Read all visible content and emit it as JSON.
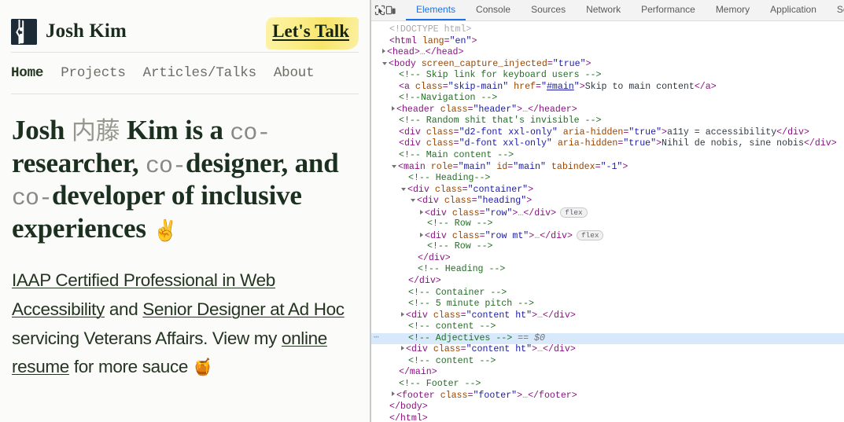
{
  "site": {
    "brand_name": "Josh Kim",
    "logo_icon": "josh-kim-monogram-icon",
    "cta": {
      "label": "Let's Talk",
      "highlight_color": "#f8e46b"
    },
    "nav": [
      {
        "label": "Home",
        "active": true
      },
      {
        "label": "Projects",
        "active": false
      },
      {
        "label": "Articles/Talks",
        "active": false
      },
      {
        "label": "About",
        "active": false
      }
    ],
    "heading": {
      "part1": "Josh ",
      "cjk": "内藤",
      "part2": " Kim is a ",
      "co1": "co-",
      "part3": "researcher, ",
      "co2": "co-",
      "part4": "designer, and ",
      "co3": "co-",
      "part5": "developer of inclusive experiences ",
      "emoji": "✌️"
    },
    "pitch": {
      "link1": "IAAP Certified Professional in Web Accessibility",
      "mid1": " and ",
      "link2": "Senior Designer at Ad Hoc",
      "mid2": " servicing Veterans Affairs. View my ",
      "link3": "online resume",
      "mid3": " for more sauce ",
      "emoji": "🍯"
    },
    "text_color": "#243521",
    "heading_color": "#1c3020"
  },
  "devtools": {
    "icons": [
      {
        "name": "inspect-element-icon"
      },
      {
        "name": "device-toolbar-icon"
      }
    ],
    "tabs": [
      {
        "label": "Elements",
        "active": true
      },
      {
        "label": "Console",
        "active": false
      },
      {
        "label": "Sources",
        "active": false
      },
      {
        "label": "Network",
        "active": false
      },
      {
        "label": "Performance",
        "active": false
      },
      {
        "label": "Memory",
        "active": false
      },
      {
        "label": "Application",
        "active": false
      },
      {
        "label": "Security",
        "active": false
      }
    ],
    "accent_color": "#1a73e8",
    "selection_color": "#d8e9fb",
    "selected_marker": "== $0",
    "dom": [
      {
        "indent": 0,
        "twisty": "none",
        "type": "doctype",
        "text": "<!DOCTYPE html>"
      },
      {
        "indent": 0,
        "twisty": "none",
        "type": "open",
        "tag": "html",
        "attrs": [
          {
            "name": "lang",
            "value": "en"
          }
        ]
      },
      {
        "indent": 0,
        "twisty": "closed",
        "type": "collapsed",
        "tag": "head"
      },
      {
        "indent": 0,
        "twisty": "open",
        "type": "open",
        "tag": "body",
        "attrs": [
          {
            "name": "screen_capture_injected",
            "value": "true"
          }
        ]
      },
      {
        "indent": 1,
        "twisty": "none",
        "type": "comment",
        "text": "<!-- Skip link for keyboard users -->"
      },
      {
        "indent": 1,
        "twisty": "none",
        "type": "anchor",
        "tag": "a",
        "attrs": [
          {
            "name": "class",
            "value": "skip-main"
          },
          {
            "name": "href",
            "value": "#main",
            "link": true
          }
        ],
        "text": "Skip to main content"
      },
      {
        "indent": 1,
        "twisty": "none",
        "type": "comment",
        "text": "<!--Navigation -->"
      },
      {
        "indent": 1,
        "twisty": "closed",
        "type": "collapsed",
        "tag": "header",
        "attrs": [
          {
            "name": "class",
            "value": "header"
          }
        ]
      },
      {
        "indent": 1,
        "twisty": "none",
        "type": "comment",
        "text": "<!-- Random shit that's invisible -->"
      },
      {
        "indent": 1,
        "twisty": "none",
        "type": "textel",
        "tag": "div",
        "attrs": [
          {
            "name": "class",
            "value": "d2-font xxl-only"
          },
          {
            "name": "aria-hidden",
            "value": "true"
          }
        ],
        "text": "a11y = accessibility"
      },
      {
        "indent": 1,
        "twisty": "none",
        "type": "textel",
        "tag": "div",
        "attrs": [
          {
            "name": "class",
            "value": "d-font xxl-only"
          },
          {
            "name": "aria-hidden",
            "value": "true"
          }
        ],
        "text": "Nihil de nobis, sine nobis"
      },
      {
        "indent": 1,
        "twisty": "none",
        "type": "comment",
        "text": "<!-- Main content -->"
      },
      {
        "indent": 1,
        "twisty": "open",
        "type": "open",
        "tag": "main",
        "attrs": [
          {
            "name": "role",
            "value": "main"
          },
          {
            "name": "id",
            "value": "main"
          },
          {
            "name": "tabindex",
            "value": "-1"
          }
        ]
      },
      {
        "indent": 2,
        "twisty": "none",
        "type": "comment",
        "text": "<!-- Heading-->"
      },
      {
        "indent": 2,
        "twisty": "open",
        "type": "open",
        "tag": "div",
        "attrs": [
          {
            "name": "class",
            "value": "container"
          }
        ]
      },
      {
        "indent": 3,
        "twisty": "open",
        "type": "open",
        "tag": "div",
        "attrs": [
          {
            "name": "class",
            "value": "heading"
          }
        ]
      },
      {
        "indent": 4,
        "twisty": "closed",
        "type": "collapsed",
        "tag": "div",
        "attrs": [
          {
            "name": "class",
            "value": "row"
          }
        ],
        "badge": "flex"
      },
      {
        "indent": 4,
        "twisty": "none",
        "type": "comment",
        "text": "<!-- Row -->"
      },
      {
        "indent": 4,
        "twisty": "closed",
        "type": "collapsed",
        "tag": "div",
        "attrs": [
          {
            "name": "class",
            "value": "row mt"
          }
        ],
        "badge": "flex"
      },
      {
        "indent": 4,
        "twisty": "none",
        "type": "comment",
        "text": "<!-- Row -->"
      },
      {
        "indent": 3,
        "twisty": "none",
        "type": "close",
        "tag": "div"
      },
      {
        "indent": 3,
        "twisty": "none",
        "type": "comment",
        "text": "<!-- Heading -->"
      },
      {
        "indent": 2,
        "twisty": "none",
        "type": "close",
        "tag": "div"
      },
      {
        "indent": 2,
        "twisty": "none",
        "type": "comment",
        "text": "<!-- Container -->"
      },
      {
        "indent": 2,
        "twisty": "none",
        "type": "comment",
        "text": "<!-- 5 minute pitch -->"
      },
      {
        "indent": 2,
        "twisty": "closed",
        "type": "collapsed",
        "tag": "div",
        "attrs": [
          {
            "name": "class",
            "value": "content ht"
          }
        ]
      },
      {
        "indent": 2,
        "twisty": "none",
        "type": "comment",
        "text": "<!-- content -->"
      },
      {
        "indent": 2,
        "twisty": "none",
        "type": "comment",
        "text": "<!-- Adjectives -->",
        "selected": true,
        "marker": "== $0"
      },
      {
        "indent": 2,
        "twisty": "closed",
        "type": "collapsed",
        "tag": "div",
        "attrs": [
          {
            "name": "class",
            "value": "content ht"
          }
        ]
      },
      {
        "indent": 2,
        "twisty": "none",
        "type": "comment",
        "text": "<!-- content -->"
      },
      {
        "indent": 1,
        "twisty": "none",
        "type": "close",
        "tag": "main"
      },
      {
        "indent": 1,
        "twisty": "none",
        "type": "comment",
        "text": "<!-- Footer -->"
      },
      {
        "indent": 1,
        "twisty": "closed",
        "type": "collapsed",
        "tag": "footer",
        "attrs": [
          {
            "name": "class",
            "value": "footer"
          }
        ]
      },
      {
        "indent": 0,
        "twisty": "none",
        "type": "close",
        "tag": "body"
      },
      {
        "indent": 0,
        "twisty": "none",
        "type": "close",
        "tag": "html"
      }
    ]
  }
}
